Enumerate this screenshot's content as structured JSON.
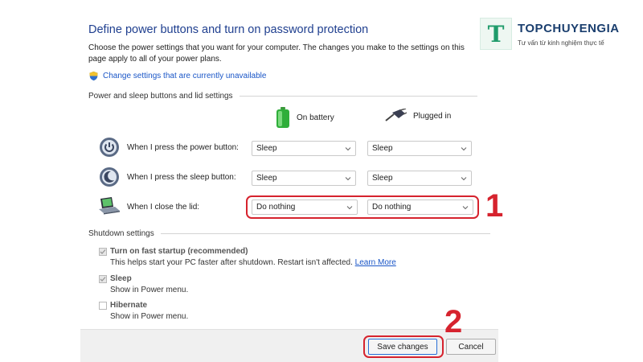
{
  "page": {
    "title": "Define power buttons and turn on password protection",
    "description": "Choose the power settings that you want for your computer. The changes you make to the settings on this page apply to all of your power plans.",
    "unavailable_link": "Change settings that are currently unavailable"
  },
  "power_section": {
    "heading": "Power and sleep buttons and lid settings",
    "col_battery": "On battery",
    "col_plugged": "Plugged in",
    "rows": [
      {
        "label": "When I press the power button:",
        "battery": "Sleep",
        "plugged": "Sleep"
      },
      {
        "label": "When I press the sleep button:",
        "battery": "Sleep",
        "plugged": "Sleep"
      },
      {
        "label": "When I close the lid:",
        "battery": "Do nothing",
        "plugged": "Do nothing"
      }
    ]
  },
  "shutdown_section": {
    "heading": "Shutdown settings",
    "fast_startup": {
      "label": "Turn on fast startup (recommended)",
      "sub": "This helps start your PC faster after shutdown. Restart isn't affected.",
      "link": "Learn More",
      "checked": true
    },
    "sleep": {
      "label": "Sleep",
      "sub": "Show in Power menu.",
      "checked": true
    },
    "hibernate": {
      "label": "Hibernate",
      "sub": "Show in Power menu.",
      "checked": false
    }
  },
  "footer": {
    "save_label": "Save changes",
    "cancel_label": "Cancel"
  },
  "annotations": {
    "step1": "1",
    "step2": "2",
    "color": "#d6232e"
  },
  "branding": {
    "logo_letter": "T",
    "name": "TOPCHUYENGIA",
    "tagline": "Tư vấn từ kinh nghiệm thực tế"
  },
  "colors": {
    "title": "#1f3f8f",
    "link": "#1a56c7",
    "brand": "#1f9b6b"
  }
}
